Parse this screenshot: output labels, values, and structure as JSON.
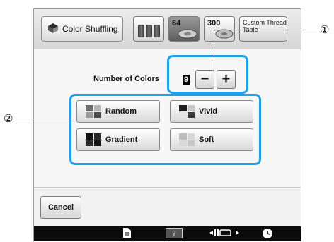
{
  "header": {
    "title": "Color Shuffling",
    "thread_buttons": [
      {
        "label": "",
        "icon": "spools-icon"
      },
      {
        "label": "64",
        "icon": "thread-64-icon",
        "selected": true
      },
      {
        "label": "300",
        "icon": "thread-300-icon"
      },
      {
        "label": "Custom Thread Table",
        "icon": "custom-table-icon"
      }
    ]
  },
  "main": {
    "number_of_colors_label": "Number of Colors",
    "number_of_colors_value": "9",
    "minus_label": "−",
    "plus_label": "+",
    "options": [
      {
        "label": "Random"
      },
      {
        "label": "Vivid"
      },
      {
        "label": "Gradient"
      },
      {
        "label": "Soft"
      }
    ]
  },
  "footer": {
    "cancel_label": "Cancel",
    "bottom_icons": [
      "document-icon",
      "help-icon",
      "presser-foot-icon",
      "clock-icon"
    ]
  },
  "callouts": {
    "one": "①",
    "two": "②"
  },
  "colors": {
    "highlight": "#1ea1e6",
    "bottom_bar": "#0b0b0b"
  }
}
